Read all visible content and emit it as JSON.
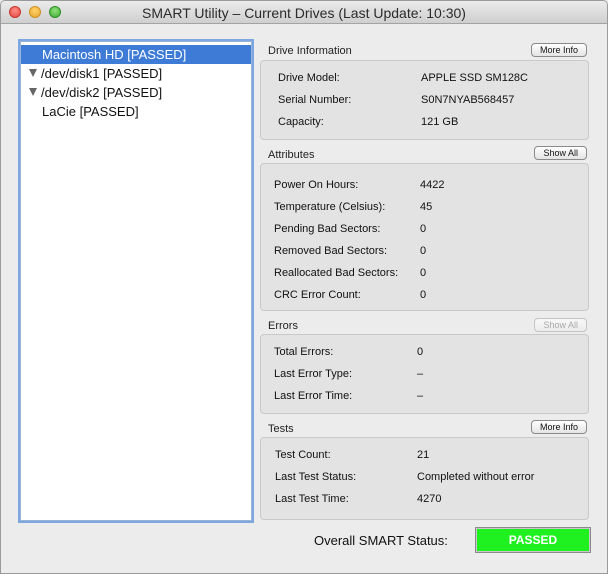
{
  "window": {
    "title": "SMART Utility – Current Drives (Last Update: 10:30)"
  },
  "drives": [
    {
      "label": "Macintosh HD  [PASSED]",
      "selected": true,
      "expandable": false
    },
    {
      "label": "/dev/disk1  [PASSED]",
      "selected": false,
      "expandable": true
    },
    {
      "label": "/dev/disk2  [PASSED]",
      "selected": false,
      "expandable": true
    },
    {
      "label": "LaCie  [PASSED]",
      "selected": false,
      "expandable": false
    }
  ],
  "drive_info": {
    "title": "Drive Information",
    "button": "More Info",
    "rows": [
      {
        "label": "Drive Model:",
        "value": "APPLE SSD SM128C"
      },
      {
        "label": "Serial Number:",
        "value": "S0N7NYAB568457"
      },
      {
        "label": "Capacity:",
        "value": "121 GB"
      }
    ]
  },
  "attributes": {
    "title": "Attributes",
    "button": "Show All",
    "rows": [
      {
        "label": "Power On Hours:",
        "value": "4422"
      },
      {
        "label": "Temperature (Celsius):",
        "value": "45"
      },
      {
        "label": "Pending Bad Sectors:",
        "value": "0"
      },
      {
        "label": "Removed Bad Sectors:",
        "value": "0"
      },
      {
        "label": "Reallocated Bad Sectors:",
        "value": "0"
      },
      {
        "label": "CRC Error Count:",
        "value": "0"
      }
    ]
  },
  "errors": {
    "title": "Errors",
    "button": "Show All",
    "rows": [
      {
        "label": "Total Errors:",
        "value": "0"
      },
      {
        "label": "Last Error Type:",
        "value": "–"
      },
      {
        "label": "Last Error Time:",
        "value": "–"
      }
    ]
  },
  "tests": {
    "title": "Tests",
    "button": "More Info",
    "rows": [
      {
        "label": "Test Count:",
        "value": "21"
      },
      {
        "label": "Last Test Status:",
        "value": "Completed without error"
      },
      {
        "label": "Last Test Time:",
        "value": "4270"
      }
    ]
  },
  "overall": {
    "label": "Overall SMART Status:",
    "status": "PASSED",
    "status_color": "#1ff01f"
  }
}
